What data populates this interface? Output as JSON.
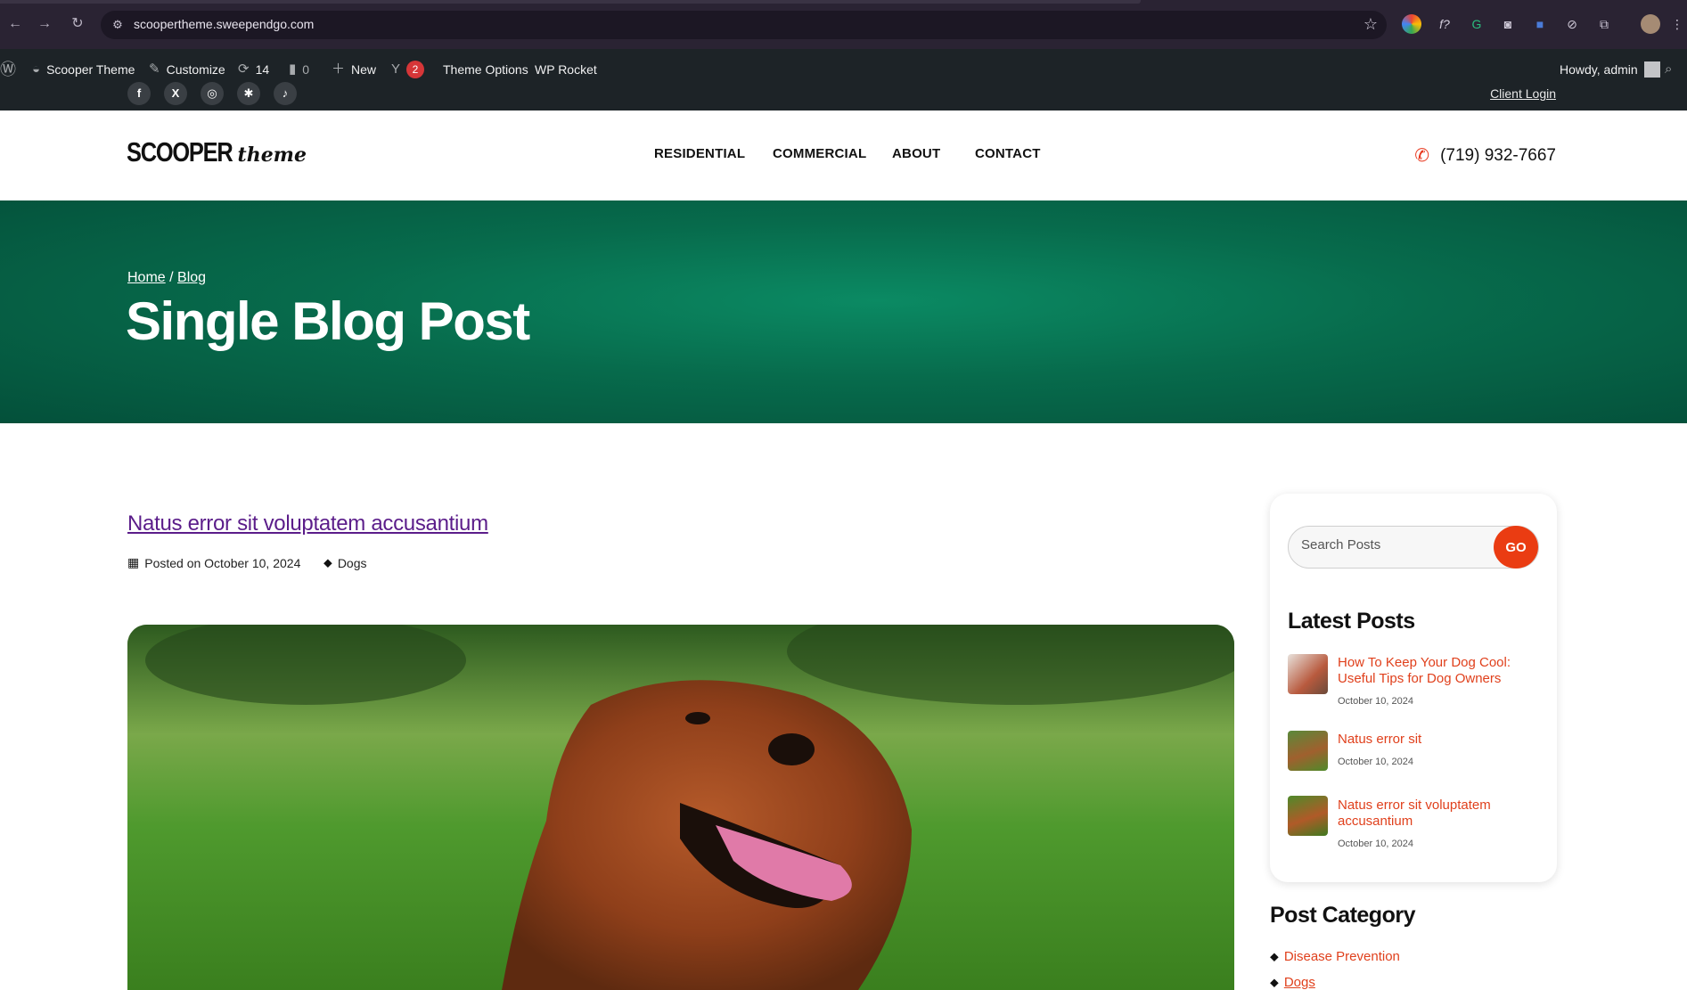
{
  "browser": {
    "url": "scoopertheme.sweependgo.com"
  },
  "admin_bar": {
    "site_name": "Scooper Theme",
    "customize": "Customize",
    "updates_count": "14",
    "comments_count": "0",
    "new_label": "New",
    "yoast_count": "2",
    "theme_options": "Theme Options",
    "wp_rocket": "WP Rocket",
    "howdy": "Howdy, admin"
  },
  "topbar": {
    "client_login": "Client Login",
    "social": [
      "facebook-icon",
      "x-icon",
      "instagram-icon",
      "yelp-icon",
      "tiktok-icon"
    ]
  },
  "header": {
    "logo_main": "SCOOPER",
    "logo_script": "theme",
    "nav": [
      "RESIDENTIAL",
      "COMMERCIAL",
      "ABOUT",
      "CONTACT"
    ],
    "phone": "(719) 932-7667"
  },
  "hero": {
    "breadcrumb_home": "Home",
    "breadcrumb_sep": "/",
    "breadcrumb_blog": "Blog",
    "title": "Single Blog Post"
  },
  "post": {
    "title": "Natus error sit voluptatem accusantium",
    "posted_on": "Posted on October 10, 2024",
    "category": "Dogs"
  },
  "sidebar": {
    "search_placeholder": "Search Posts",
    "go_label": "GO",
    "latest_heading": "Latest Posts",
    "latest": [
      {
        "title": "How To Keep Your Dog Cool: Useful Tips for Dog Owners",
        "date": "October 10, 2024"
      },
      {
        "title": "Natus error sit",
        "date": "October 10, 2024"
      },
      {
        "title": "Natus error sit voluptatem accusantium",
        "date": "October 10, 2024"
      }
    ],
    "category_heading": "Post Category",
    "categories": [
      "Disease Prevention",
      "Dogs"
    ]
  },
  "colors": {
    "accent": "#e0401c",
    "hero_green": "#076b4c",
    "link_purple": "#5b1d8a"
  }
}
